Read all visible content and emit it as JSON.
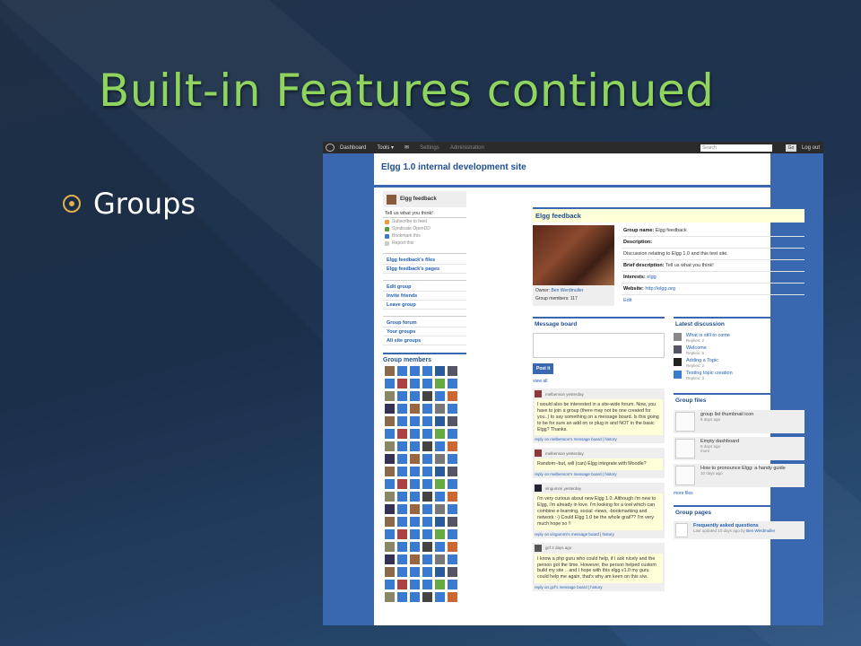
{
  "slide": {
    "title": "Built-in Features continued",
    "bullet": "Groups"
  },
  "topbar": {
    "dashboard": "Dashboard",
    "tools": "Tools ▾",
    "mail_icon": "✉",
    "settings": "Settings",
    "administration": "Administration",
    "search_placeholder": "Search",
    "go": "Go",
    "logout": "Log out"
  },
  "site": {
    "title": "Elgg 1.0 internal development site"
  },
  "sidebar": {
    "group_name": "Elgg feedback",
    "description": "Tell us what you think!",
    "tools": [
      "Subscribe to feed",
      "Syndicate OpenDD",
      "Bookmark this",
      "Report this"
    ],
    "links_a": [
      "Elgg feedback's files",
      "Elgg feedback's pages"
    ],
    "links_b": [
      "Edit group",
      "Invite friends",
      "Leave group"
    ],
    "links_c": [
      "Group forum",
      "Your groups",
      "All site groups"
    ],
    "members_title": "Group members"
  },
  "profile": {
    "header": "Elgg feedback",
    "owner_label": "Owner:",
    "owner_name": "Ben Werdmuller",
    "members_count": "Group members: 117",
    "group_name_label": "Group name:",
    "group_name": "Elgg feedback",
    "description_label": "Description:",
    "description": "Discussion relating to Elgg 1.0 and this test site.",
    "brief_label": "Brief description:",
    "brief": "Tell us what you think!",
    "interests_label": "Interests:",
    "interests": "elgg",
    "website_label": "Website:",
    "website": "http://elgg.org",
    "edit": "Edit"
  },
  "message_board": {
    "title": "Message board",
    "post_button": "Post it",
    "view_all": "view all",
    "messages": [
      {
        "author": "melbenson yesterday",
        "body": "I would also be interested in a site-wide forum. Now, you have to join a group (there may not be one created for you..) to say something on a message board. Is this going to be for sure an add on or plug in and NOT in the basic Elgg? Thanks.",
        "foot": "reply on melbenson's message board | history"
      },
      {
        "author": "melbenson yesterday",
        "body": "Random--but, will (can) Elgg integrate with Moodle?",
        "foot": "reply on melbenson's message board | history"
      },
      {
        "author": "vingummi yesterday",
        "body": "i'm very curious about new Elgg 1.0. Although i'm new to Elgg, i'm already in love. I'm looking for a tool which can combine e-learning, social -news, -bookmarking and network :-) Could Elgg 1.0 be the whole grail?? I'm very much hope so !!",
        "foot": "reply on vingummi's message board | history"
      },
      {
        "author": "gcf 2 days ago",
        "body": "I know a php guru who could help, if I ask nicely and the person got the time. However, the person helped custom build my site .. and I hope with this elgg v1.0 my guru could help me again, that's why am keen on this s/w.",
        "foot": "reply on gcf's message board | history"
      }
    ]
  },
  "latest_discussion": {
    "title": "Latest discussion",
    "items": [
      {
        "title": "What is still to come",
        "replies": "Replies: 2"
      },
      {
        "title": "Welcome",
        "replies": "Replies: 5"
      },
      {
        "title": "Adding a Topic",
        "replies": "Replies: 2"
      },
      {
        "title": "Testing topic creation",
        "replies": "Replies: 3"
      }
    ]
  },
  "group_files": {
    "title": "Group files",
    "items": [
      {
        "title": "group list thumbnail icon",
        "meta": "8 days ago",
        "extra": ""
      },
      {
        "title": "Empty dashboard",
        "meta": "8 days ago",
        "extra": "more"
      },
      {
        "title": "How to pronounce Elgg: a handy guide",
        "meta": "10 days ago",
        "extra": ""
      }
    ],
    "more": "more files"
  },
  "group_pages": {
    "title": "Group pages",
    "item_title": "Frequently asked questions",
    "item_meta": "Last updated 10 days ago by",
    "item_author": "Ben Werdmuller"
  },
  "colors": {
    "title_green": "#8fd45f",
    "elgg_blue": "#3a68b0",
    "link_blue": "#1f5fb0"
  }
}
